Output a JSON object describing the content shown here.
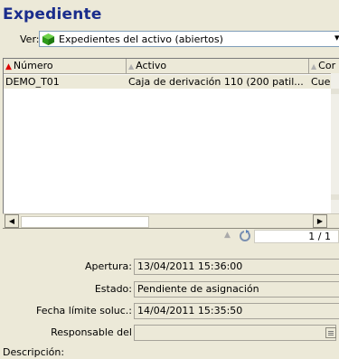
{
  "title": "Expediente",
  "view": {
    "label": "Ver:",
    "selected": "Expedientes del activo (abiertos)"
  },
  "grid": {
    "columns": [
      "Número",
      "Activo",
      "Cor"
    ],
    "rows": [
      [
        "DEMO_T01",
        "Caja de derivación 110 (200 patil...",
        "Cuerv"
      ]
    ],
    "count": "1 / 1"
  },
  "form": {
    "apertura_label": "Apertura:",
    "apertura_value": "13/04/2011 15:36:00",
    "estado_label": "Estado:",
    "estado_value": "Pendiente de asignación",
    "fecha_label": "Fecha límite soluc.:",
    "fecha_value": "14/04/2011 15:35:50",
    "responsable_label": "Responsable del",
    "responsable_value": "",
    "descripcion_label": "Descripción:"
  },
  "colors": {
    "title": "#1a2d8c",
    "panel": "#ece9d8",
    "sort_active": "#d00000"
  },
  "icons": {
    "view": "green-cube-icon",
    "status": "recycle-icon",
    "lookup": "lookup-icon"
  }
}
